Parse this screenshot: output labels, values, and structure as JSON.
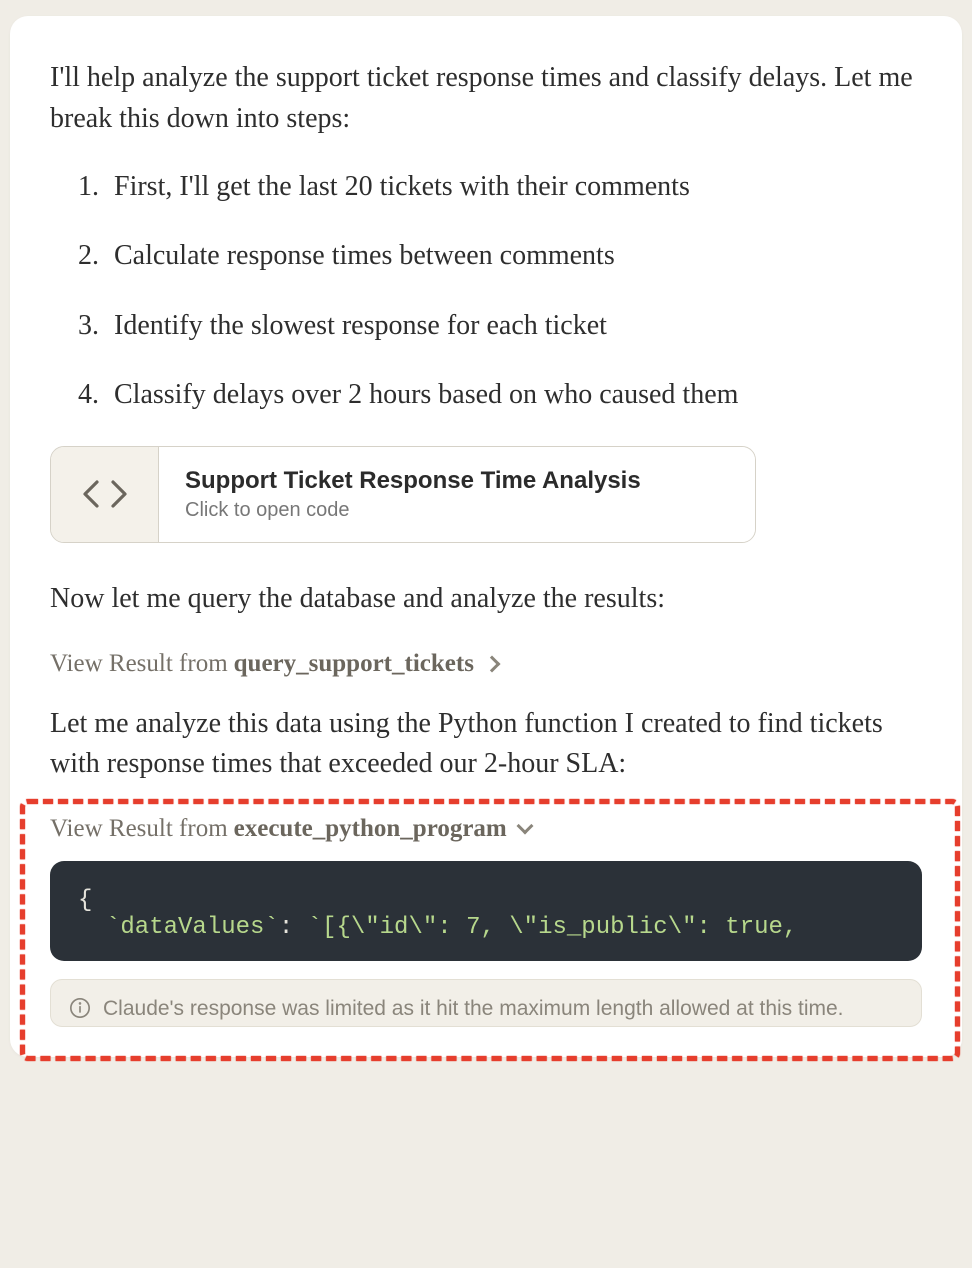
{
  "message": {
    "intro": "I'll help analyze the support ticket response times and classify delays. Let me break this down into steps:",
    "steps": [
      "First, I'll get the last 20 tickets with their comments",
      "Calculate response times between comments",
      "Identify the slowest response for each ticket",
      "Classify delays over 2 hours based on who caused them"
    ],
    "artifact": {
      "title": "Support Ticket Response Time Analysis",
      "subtitle": "Click to open code"
    },
    "after_artifact": "Now let me query the database and analyze the results:",
    "result_toggle_1": {
      "prefix": "View Result from ",
      "fn": "query_support_tickets"
    },
    "after_result_1": "Let me analyze this data using the Python function I created to find tickets with response times that exceeded our 2-hour SLA:",
    "result_toggle_2": {
      "prefix": "View Result from ",
      "fn": "execute_python_program"
    },
    "code": {
      "line1": "{",
      "line2_key": "`dataValues`",
      "line2_sep": ": ",
      "line2_val": "`[{\\\"id\\\": 7, \\\"is_public\\\": true,"
    },
    "notice": "Claude's response was limited as it hit the maximum length allowed at this time."
  }
}
